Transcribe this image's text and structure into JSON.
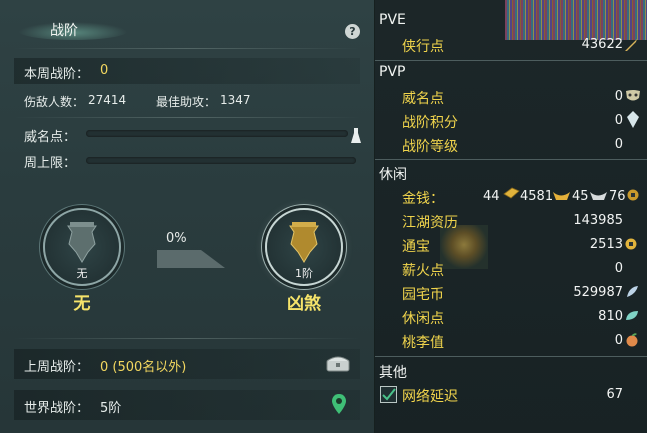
{
  "left": {
    "title": "战阶",
    "help": "?",
    "week_rank_label": "本周战阶：",
    "week_rank_value": "0",
    "kills_label": "伤敌人数：",
    "kills_value": "27414",
    "assists_label": "最佳助攻：",
    "assists_value": "1347",
    "prestige_label": "威名点：",
    "weekly_cap_label": "周上限：",
    "current_rank": {
      "caption": "无",
      "name": "无"
    },
    "next_rank": {
      "caption": "1阶",
      "name": "凶煞"
    },
    "progress_text": "0%",
    "progress": 0,
    "last_week_label": "上周战阶：",
    "last_week_value": "0 (500名以外)",
    "world_rank_label": "世界战阶：",
    "world_rank_value": "5阶"
  },
  "right": {
    "pve": {
      "header": "PVE",
      "items": [
        {
          "label": "侠行点",
          "value": "43622",
          "icon": "sword-icon"
        }
      ]
    },
    "pvp": {
      "header": "PVP",
      "items": [
        {
          "label": "威名点",
          "value": "0",
          "icon": "mask-icon"
        },
        {
          "label": "战阶积分",
          "value": "0",
          "icon": "crystal-icon"
        },
        {
          "label": "战阶等级",
          "value": "0"
        }
      ]
    },
    "leisure": {
      "header": "休闲",
      "money_label": "金钱：",
      "gold_bar": "44",
      "gold_ingot": "4581",
      "silver_ingot": "45",
      "coin": "76",
      "items": [
        {
          "label": "江湖资历",
          "value": "143985"
        },
        {
          "label": "通宝",
          "value": "2513",
          "icon": "coin-icon"
        },
        {
          "label": "薪火点",
          "value": "0"
        },
        {
          "label": "园宅币",
          "value": "529987",
          "icon": "feather-icon"
        },
        {
          "label": "休闲点",
          "value": "810",
          "icon": "leaf-icon"
        },
        {
          "label": "桃李值",
          "value": "0",
          "icon": "peach-icon"
        }
      ]
    },
    "other": {
      "header": "其他",
      "items": [
        {
          "label": "网络延迟",
          "value": "67",
          "checked": true
        }
      ]
    }
  }
}
